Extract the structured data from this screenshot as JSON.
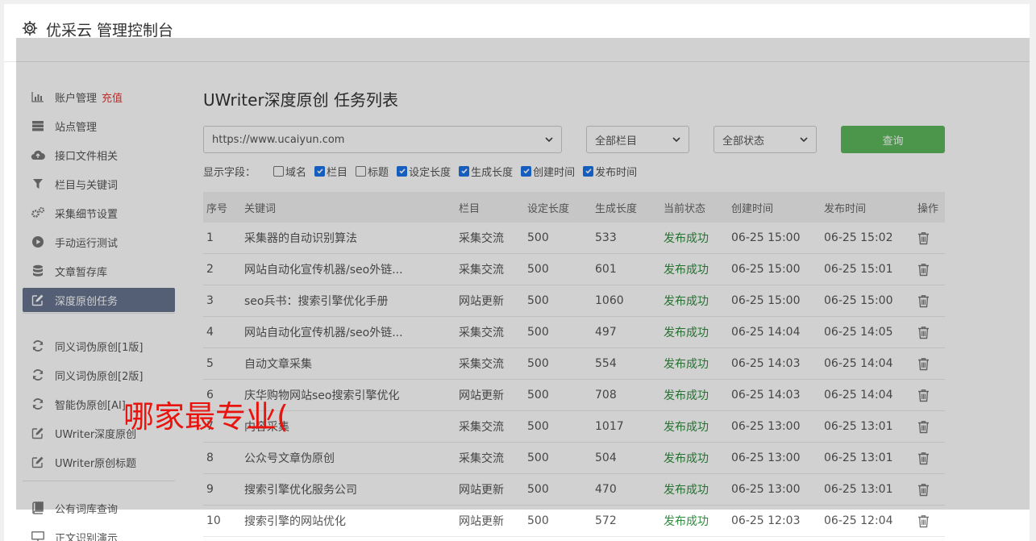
{
  "header": {
    "title": "优采云 管理控制台"
  },
  "sidebar": {
    "items": [
      {
        "label": "账户管理",
        "extra": "充值",
        "icon": "bar-chart-icon"
      },
      {
        "label": "站点管理",
        "icon": "server-icon"
      },
      {
        "label": "接口文件相关",
        "icon": "cloud-upload-icon"
      },
      {
        "label": "栏目与关键词",
        "icon": "filter-icon"
      },
      {
        "label": "采集细节设置",
        "icon": "gears-icon"
      },
      {
        "label": "手动运行测试",
        "icon": "play-circle-icon"
      },
      {
        "label": "文章暂存库",
        "icon": "database-icon"
      },
      {
        "label": "深度原创任务",
        "icon": "edit-icon",
        "active": true
      },
      {
        "label": "同义词伪原创[1版]",
        "icon": "refresh-icon"
      },
      {
        "label": "同义词伪原创[2版]",
        "icon": "refresh-icon"
      },
      {
        "label": "智能伪原创[AI]",
        "icon": "refresh-icon"
      },
      {
        "label": "UWriter深度原创",
        "icon": "edit-icon"
      },
      {
        "label": "UWriter原创标题",
        "icon": "edit-icon"
      },
      {
        "label": "公有词库查询",
        "icon": "book-icon"
      },
      {
        "label": "正文识别演示",
        "icon": "monitor-icon"
      }
    ]
  },
  "main": {
    "title": "UWriter深度原创 任务列表",
    "site_select": "https://www.ucaiyun.com",
    "column_select": "全部栏目",
    "status_select": "全部状态",
    "query_label": "查询",
    "fields_label": "显示字段：",
    "fields": [
      {
        "label": "域名",
        "checked": false
      },
      {
        "label": "栏目",
        "checked": true
      },
      {
        "label": "标题",
        "checked": false
      },
      {
        "label": "设定长度",
        "checked": true
      },
      {
        "label": "生成长度",
        "checked": true
      },
      {
        "label": "创建时间",
        "checked": true
      },
      {
        "label": "发布时间",
        "checked": true
      }
    ],
    "columns": [
      "序号",
      "关键词",
      "栏目",
      "设定长度",
      "生成长度",
      "当前状态",
      "创建时间",
      "发布时间",
      "操作"
    ],
    "rows": [
      [
        "1",
        "采集器的自动识别算法",
        "采集交流",
        "500",
        "533",
        "发布成功",
        "06-25 15:00",
        "06-25 15:02"
      ],
      [
        "2",
        "网站自动化宣传机器/seo外链...",
        "采集交流",
        "500",
        "601",
        "发布成功",
        "06-25 15:00",
        "06-25 15:01"
      ],
      [
        "3",
        "seo兵书：搜索引擎优化手册",
        "网站更新",
        "500",
        "1060",
        "发布成功",
        "06-25 15:00",
        "06-25 15:00"
      ],
      [
        "4",
        "网站自动化宣传机器/seo外链...",
        "采集交流",
        "500",
        "497",
        "发布成功",
        "06-25 14:04",
        "06-25 14:05"
      ],
      [
        "5",
        "自动文章采集",
        "采集交流",
        "500",
        "554",
        "发布成功",
        "06-25 14:03",
        "06-25 14:04"
      ],
      [
        "6",
        "庆华购物网站seo搜索引擎优化",
        "网站更新",
        "500",
        "708",
        "发布成功",
        "06-25 14:03",
        "06-25 14:04"
      ],
      [
        "7",
        "内容采集",
        "采集交流",
        "500",
        "1017",
        "发布成功",
        "06-25 13:00",
        "06-25 13:01"
      ],
      [
        "8",
        "公众号文章伪原创",
        "采集交流",
        "500",
        "504",
        "发布成功",
        "06-25 13:00",
        "06-25 13:01"
      ],
      [
        "9",
        "搜索引擎优化服务公司",
        "网站更新",
        "500",
        "470",
        "发布成功",
        "06-25 13:00",
        "06-25 13:01"
      ],
      [
        "10",
        "搜索引擎的网站优化",
        "网站更新",
        "500",
        "572",
        "发布成功",
        "06-25 12:03",
        "06-25 12:04"
      ]
    ]
  },
  "watermark": "哪家最专业(",
  "colors": {
    "active_bg": "#67738f",
    "query_btn": "#5cb85c",
    "status_ok": "#2e8b3c",
    "recharge": "#e53935",
    "watermark": "#e8140d"
  }
}
